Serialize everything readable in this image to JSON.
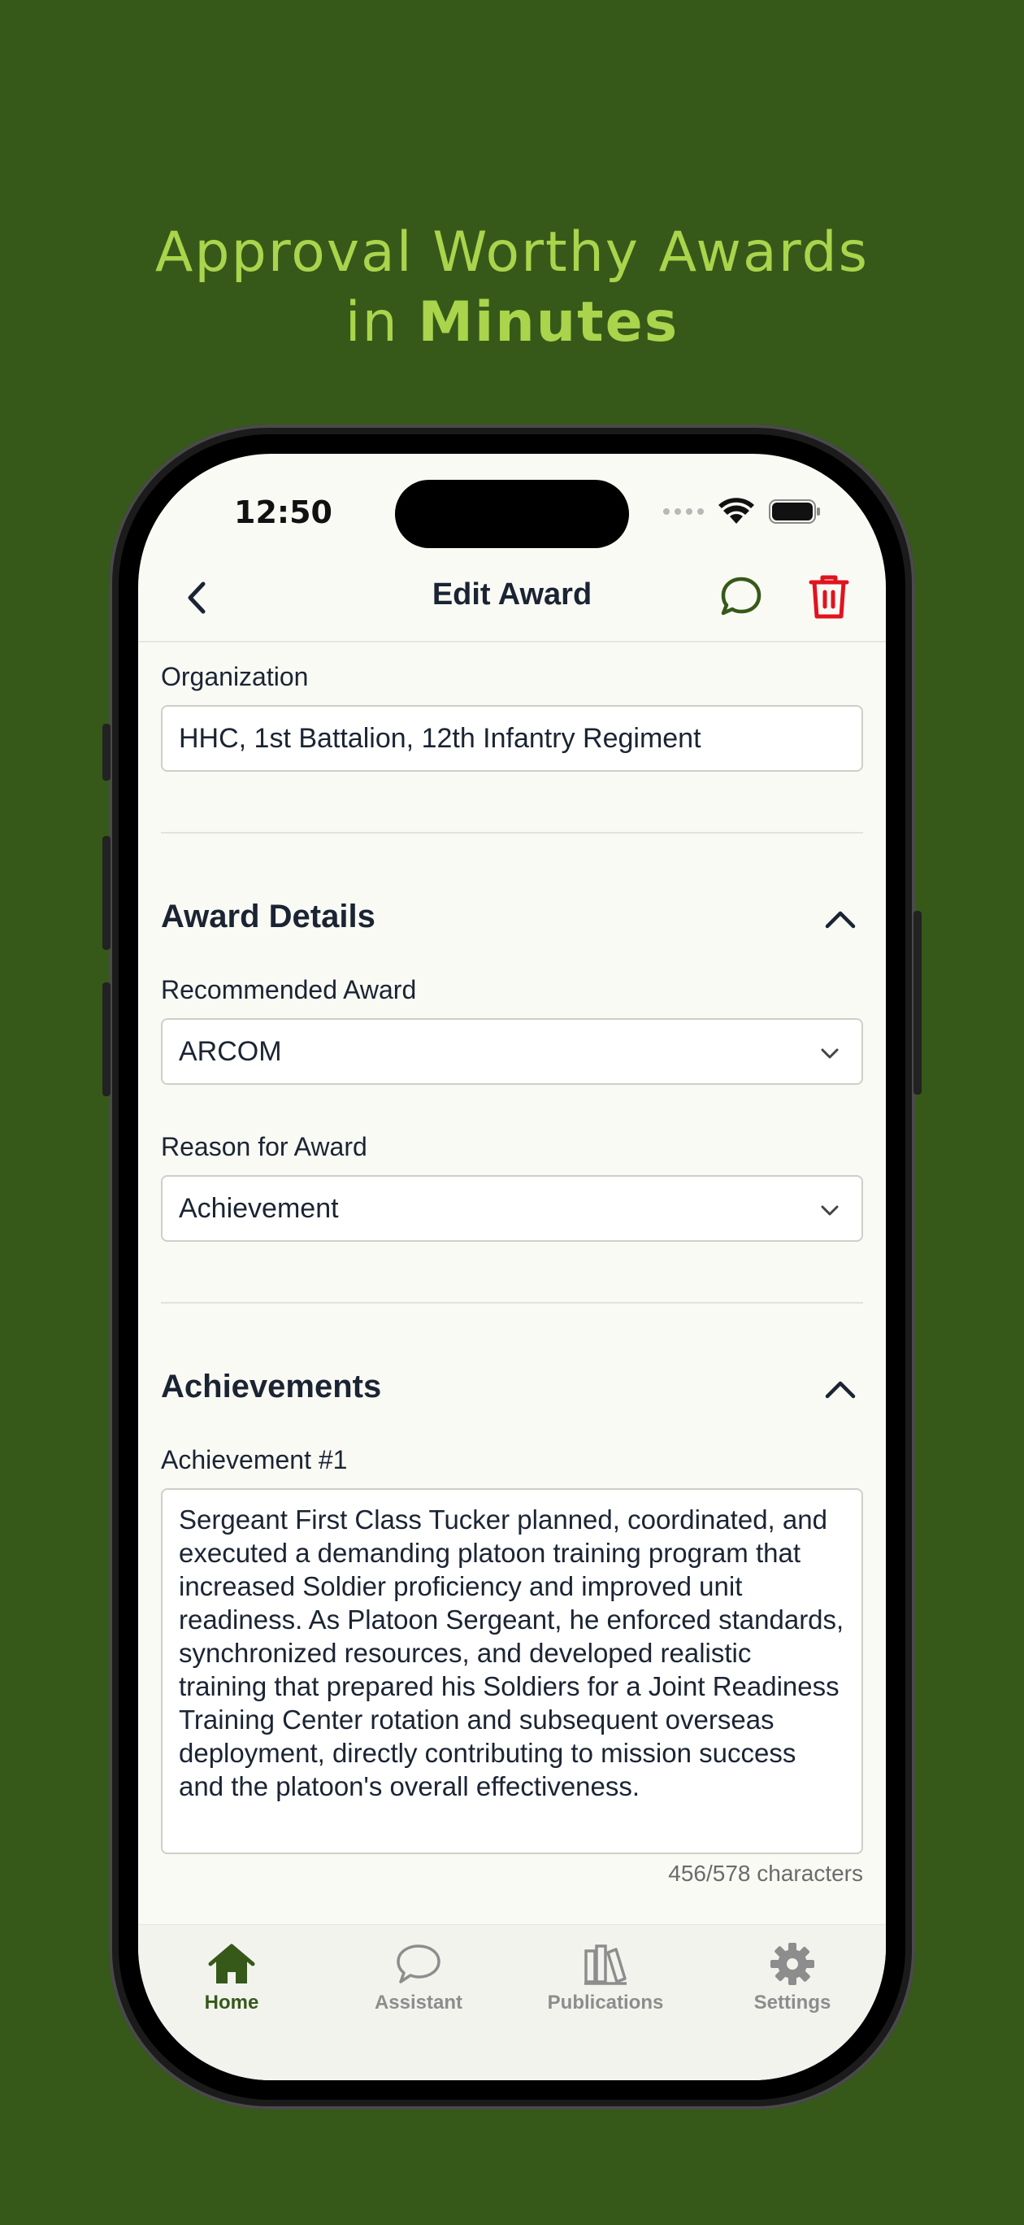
{
  "headline": {
    "line1": "Approval Worthy Awards",
    "line2_prefix": "in ",
    "line2_bold": "Minutes"
  },
  "status": {
    "time": "12:50"
  },
  "nav": {
    "title": "Edit Award"
  },
  "organization": {
    "label": "Organization",
    "value": "HHC, 1st Battalion, 12th Infantry Regiment"
  },
  "award_details": {
    "title": "Award Details",
    "recommended_label": "Recommended Award",
    "recommended_value": "ARCOM",
    "reason_label": "Reason for Award",
    "reason_value": "Achievement"
  },
  "achievements": {
    "title": "Achievements",
    "item_label": "Achievement #1",
    "item_text": "Sergeant First Class Tucker planned, coordinated, and executed a demanding platoon training program that increased Soldier proficiency and improved unit readiness. As Platoon Sergeant, he enforced standards, synchronized resources, and developed realistic training that prepared his Soldiers for a Joint Readiness Training Center rotation and subsequent overseas deployment, directly contributing to mission success and the platoon's overall effectiveness.",
    "counter": "456/578 characters"
  },
  "tabs": [
    {
      "label": "Home",
      "icon": "home-icon",
      "active": true
    },
    {
      "label": "Assistant",
      "icon": "chat-bubble-icon",
      "active": false
    },
    {
      "label": "Publications",
      "icon": "books-icon",
      "active": false
    },
    {
      "label": "Settings",
      "icon": "gear-icon",
      "active": false
    }
  ],
  "colors": {
    "background": "#36591a",
    "accent": "#a9d44c",
    "active_tab": "#36591a",
    "delete": "#e0141e"
  }
}
